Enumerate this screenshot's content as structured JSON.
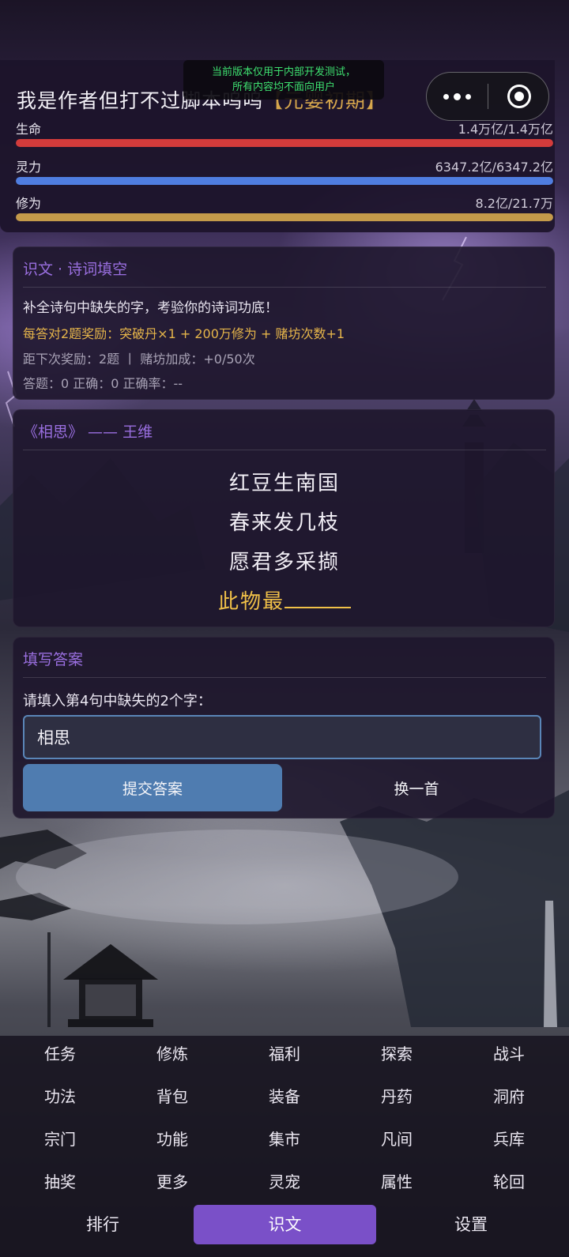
{
  "colors": {
    "hp_bar": "#d33b3b",
    "mp_bar": "#4f7de0",
    "xp_bar": "#c49a4a",
    "accent_purple": "#9a6fe0",
    "reward_gold": "#e6b54a",
    "active_tab": "#7a50c8",
    "submit_button": "#4f7cb0",
    "dev_notice_text": "#3ee070"
  },
  "dev_notice": {
    "line1": "当前版本仅用于内部开发测试，",
    "line2": "所有内容均不面向用户"
  },
  "capsule": {
    "more_icon": "more-dots-icon",
    "close_icon": "target-circle-icon"
  },
  "player": {
    "name": "我是作者但打不过脚本呜呜",
    "realm": "【元婴初期】"
  },
  "stats": {
    "hp": {
      "label": "生命",
      "value": "1.4万亿/1.4万亿",
      "fill": 1.0
    },
    "mp": {
      "label": "灵力",
      "value": "6347.2亿/6347.2亿",
      "fill": 1.0
    },
    "xp": {
      "label": "修为",
      "value": "8.2亿/21.7万",
      "fill": 1.0
    }
  },
  "rules_card": {
    "title": "识文 · 诗词填空",
    "description": "补全诗句中缺失的字，考验你的诗词功底！",
    "reward": "每答对2题奖励：突破丹×1 + 200万修为 + 赌坊次数+1",
    "next_reward": "距下次奖励：2题 丨 赌坊加成：+0/50次",
    "score": "答题：0   正确：0   正确率：--"
  },
  "poem_card": {
    "title": "《相思》 —— 王维",
    "lines": [
      "红豆生南国",
      "春来发几枝",
      "愿君多采撷"
    ],
    "missing_line_prefix": "此物最"
  },
  "answer_card": {
    "title": "填写答案",
    "prompt": "请填入第4句中缺失的2个字：",
    "input_value": "相思",
    "submit_label": "提交答案",
    "switch_label": "换一首"
  },
  "bottom_nav": {
    "rows": [
      [
        "任务",
        "修炼",
        "福利",
        "探索",
        "战斗"
      ],
      [
        "功法",
        "背包",
        "装备",
        "丹药",
        "洞府"
      ],
      [
        "宗门",
        "功能",
        "集市",
        "凡间",
        "兵库"
      ],
      [
        "抽奖",
        "更多",
        "灵宠",
        "属性",
        "轮回"
      ]
    ],
    "last_row": [
      "排行",
      "识文",
      "设置"
    ],
    "active": "识文"
  }
}
